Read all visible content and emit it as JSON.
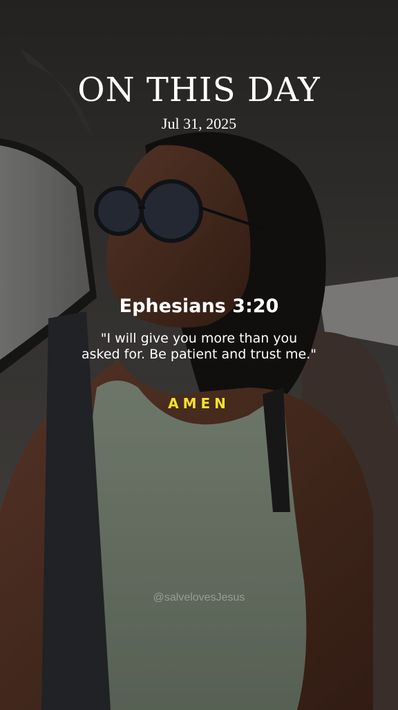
{
  "header": {
    "title": "ON THIS DAY",
    "date": "Jul 31, 2025"
  },
  "verse": {
    "reference": "Ephesians 3:20",
    "text": "\"I will give you more than you asked for. Be patient and trust me.\"",
    "closing": "AMEN"
  },
  "watermark": "@salvelovesJesus",
  "colors": {
    "accent": "#f3e22b",
    "text": "#ffffff"
  }
}
